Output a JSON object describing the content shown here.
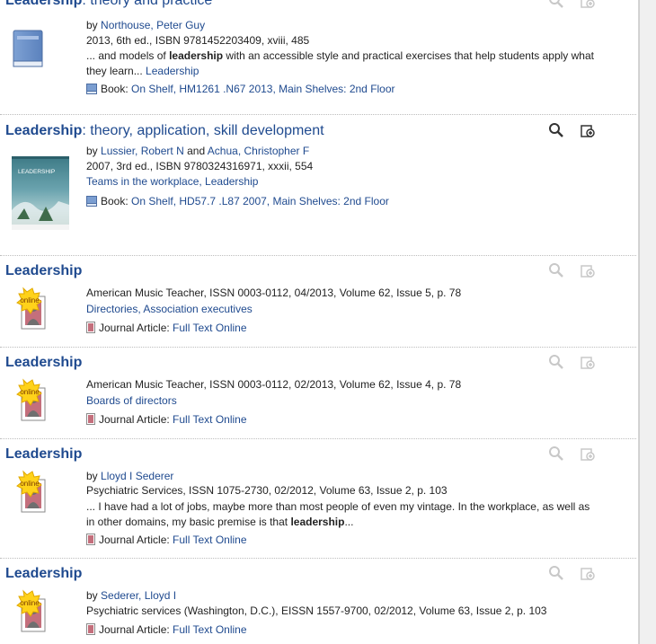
{
  "results": [
    {
      "title_bold": "Leadership",
      "title_rest": ": theory and practice",
      "by_label": "by",
      "authors": [
        "Northouse, Peter Guy"
      ],
      "pub_line": "2013, 6th ed., ISBN 9781452203409, xviii, 485",
      "snippet_pre": "... and models of ",
      "snippet_bold": "leadership",
      "snippet_mid": " with an accessible style and practical exercises that help students apply what they learn... ",
      "subject_link": "Leadership",
      "format_label": "Book:",
      "availability": "On Shelf, HM1261 .N67 2013, Main Shelves: 2nd Floor",
      "tools_active": false
    },
    {
      "title_bold": "Leadership",
      "title_rest": ": theory, application, skill development",
      "by_label": "by",
      "author1": "Lussier, Robert N",
      "and_label": "and",
      "author2": "Achua, Christopher F",
      "pub_line": "2007, 3rd ed., ISBN 9780324316971, xxxii, 554",
      "subjects": "Teams in the workplace, Leadership",
      "format_label": "Book:",
      "availability": "On Shelf, HD57.7 .L87 2007, Main Shelves: 2nd Floor",
      "cover_text": "LEADERSHIP",
      "tools_active": true
    },
    {
      "title_bold": "Leadership",
      "pub_line": "American Music Teacher, ISSN 0003-0112, 04/2013, Volume 62, Issue 5, p. 78",
      "subjects": "Directories, Association executives",
      "format_label": "Journal Article:",
      "availability": "Full Text Online",
      "badge": "online"
    },
    {
      "title_bold": "Leadership",
      "pub_line": "American Music Teacher, ISSN 0003-0112, 02/2013, Volume 62, Issue 4, p. 78",
      "subjects": "Boards of directors",
      "format_label": "Journal Article:",
      "availability": "Full Text Online",
      "badge": "online"
    },
    {
      "title_bold": "Leadership",
      "by_label": "by",
      "author": "Lloyd I Sederer",
      "pub_line": "Psychiatric Services, ISSN 1075-2730, 02/2012, Volume 63, Issue 2, p. 103",
      "snippet_pre": "... I have had a lot of jobs, maybe more than most people of even my vintage. In the workplace, as well as in other domains, my basic premise is that ",
      "snippet_bold": "leadership",
      "snippet_post": "...",
      "format_label": "Journal Article:",
      "availability": "Full Text Online",
      "badge": "online"
    },
    {
      "title_bold": "Leadership",
      "by_label": "by",
      "author": "Sederer, Lloyd I",
      "pub_line": "Psychiatric services (Washington, D.C.), EISSN 1557-9700, 02/2012, Volume 63, Issue 2, p. 103",
      "format_label": "Journal Article:",
      "availability": "Full Text Online",
      "badge": "online"
    }
  ],
  "colors": {
    "link": "#1f4a8f",
    "badge": "#ffd21a",
    "badge_text": "#7a3b00",
    "icon_inactive": "#b8b8b8",
    "icon_active": "#333333"
  },
  "icons": {
    "preview": "magnifier-icon",
    "save": "save-to-folder-icon",
    "book": "book-icon",
    "article": "article-icon"
  }
}
